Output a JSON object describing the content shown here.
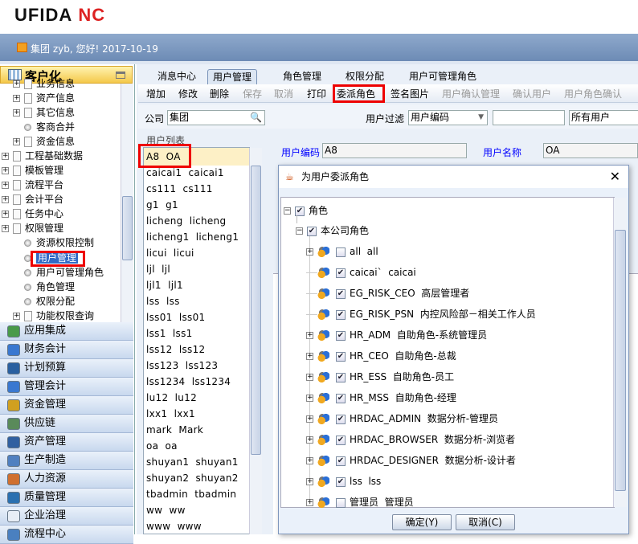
{
  "app": {
    "logo_text": "UFIDA",
    "logo_mark": "NC",
    "greeting": "集团 zyb, 您好! 2017-10-19"
  },
  "sidebar": {
    "title": "客户化",
    "tree": [
      {
        "label": "业务信息",
        "kind": "doc",
        "level": 1
      },
      {
        "label": "资产信息",
        "kind": "doc",
        "level": 1
      },
      {
        "label": "其它信息",
        "kind": "doc",
        "level": 1
      },
      {
        "label": "客商合并",
        "kind": "leaf",
        "level": 1
      },
      {
        "label": "资金信息",
        "kind": "doc",
        "level": 1
      },
      {
        "label": "工程基础数据",
        "kind": "doc",
        "level": 0
      },
      {
        "label": "模板管理",
        "kind": "doc",
        "level": 0
      },
      {
        "label": "流程平台",
        "kind": "doc",
        "level": 0
      },
      {
        "label": "会计平台",
        "kind": "doc",
        "level": 0
      },
      {
        "label": "任务中心",
        "kind": "doc",
        "level": 0
      },
      {
        "label": "权限管理",
        "kind": "doc",
        "level": 0
      },
      {
        "label": "资源权限控制",
        "kind": "leaf",
        "level": 1
      },
      {
        "label": "用户管理",
        "kind": "leaf",
        "level": 1,
        "selected": true
      },
      {
        "label": "用户可管理角色",
        "kind": "leaf",
        "level": 1
      },
      {
        "label": "角色管理",
        "kind": "leaf",
        "level": 1
      },
      {
        "label": "权限分配",
        "kind": "leaf",
        "level": 1
      },
      {
        "label": "功能权限查询",
        "kind": "doc",
        "level": 1
      }
    ],
    "modules": [
      "应用集成",
      "财务会计",
      "计划预算",
      "管理会计",
      "资金管理",
      "供应链",
      "资产管理",
      "生产制造",
      "人力资源",
      "质量管理",
      "企业治理",
      "流程中心"
    ]
  },
  "tabs": [
    "消息中心",
    "用户管理",
    "角色管理",
    "权限分配",
    "用户可管理角色"
  ],
  "toolbar": [
    {
      "label": "增加",
      "enabled": true
    },
    {
      "label": "修改",
      "enabled": true
    },
    {
      "label": "删除",
      "enabled": true
    },
    {
      "label": "保存",
      "enabled": false
    },
    {
      "label": "取消",
      "enabled": false
    },
    {
      "label": "打印",
      "enabled": true
    },
    {
      "label": "委派角色",
      "enabled": true
    },
    {
      "label": "签名图片",
      "enabled": true
    },
    {
      "label": "用户确认管理",
      "enabled": false
    },
    {
      "label": "确认用户",
      "enabled": false
    },
    {
      "label": "用户角色确认",
      "enabled": false
    }
  ],
  "filter": {
    "company_label": "公司",
    "company_value": "集团",
    "user_filter_label": "用户过滤",
    "user_filter_select": "用户编码",
    "user_filter_text": "",
    "user_scope": "所有用户"
  },
  "user_list": {
    "title": "用户列表",
    "items": [
      "A8  OA",
      "caicai1  caicai1",
      "cs111  cs111",
      "g1  g1",
      "licheng  licheng",
      "licheng1  licheng1",
      "licui  licui",
      "ljl  ljl",
      "ljl1  ljl1",
      "lss  lss",
      "lss01  lss01",
      "lss1  lss1",
      "lss12  lss12",
      "lss123  lss123",
      "lss1234  lss1234",
      "lu12  lu12",
      "lxx1  lxx1",
      "mark  Mark",
      "oa  oa",
      "shuyan1  shuyan1",
      "shuyan2  shuyan2",
      "tbadmin  tbadmin",
      "ww  ww",
      "www  www"
    ]
  },
  "detail": {
    "code_label": "用户编码",
    "code_value": "A8",
    "name_label": "用户名称",
    "name_value": "OA"
  },
  "dialog": {
    "title": "为用户委派角色",
    "root": "角色",
    "group": "本公司角色",
    "roles": [
      {
        "label": "all  all",
        "checked": false,
        "expandable": true
      },
      {
        "label": "caicai`  caicai",
        "checked": true,
        "expandable": false
      },
      {
        "label": "EG_RISK_CEO  高层管理者",
        "checked": true,
        "expandable": false
      },
      {
        "label": "EG_RISK_PSN  内控风险部－相关工作人员",
        "checked": true,
        "expandable": false
      },
      {
        "label": "HR_ADM  自助角色-系统管理员",
        "checked": true,
        "expandable": true
      },
      {
        "label": "HR_CEO  自助角色-总裁",
        "checked": true,
        "expandable": true
      },
      {
        "label": "HR_ESS  自助角色-员工",
        "checked": true,
        "expandable": true
      },
      {
        "label": "HR_MSS  自助角色-经理",
        "checked": true,
        "expandable": true
      },
      {
        "label": "HRDAC_ADMIN  数据分析-管理员",
        "checked": true,
        "expandable": true
      },
      {
        "label": "HRDAC_BROWSER  数据分析-浏览者",
        "checked": true,
        "expandable": true
      },
      {
        "label": "HRDAC_DESIGNER  数据分析-设计者",
        "checked": true,
        "expandable": true
      },
      {
        "label": "lss  lss",
        "checked": true,
        "expandable": true
      },
      {
        "label": "管理员  管理员",
        "checked": false,
        "expandable": true
      }
    ],
    "ok": "确定(Y)",
    "cancel": "取消(C)"
  }
}
